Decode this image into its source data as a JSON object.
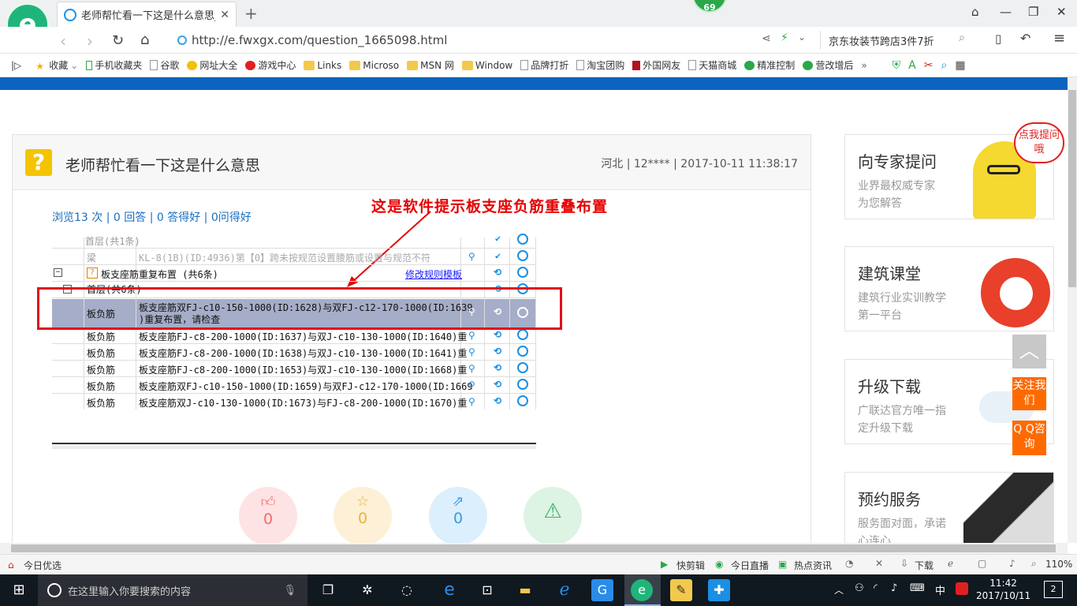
{
  "browser": {
    "tab_title": "老师帮忙看一下这是什么意思_广",
    "badge": "69",
    "url": "http://e.fwxgx.com/question_1665098.html",
    "search_placeholder": "京东妆装节跨店3件7折"
  },
  "bookmarks": [
    "收藏",
    "手机收藏夹",
    "谷歌",
    "网址大全",
    "游戏中心",
    "Links",
    "Microso",
    "MSN 网",
    "Window",
    "品牌打折",
    "淘宝团购",
    "外国网友",
    "天猫商城",
    "精准控制",
    "营改增后"
  ],
  "question": {
    "icon": "?",
    "title": "老师帮忙看一下这是什么意思",
    "meta": "河北 | 12**** | 2017-10-11 11:38:17",
    "stats": "浏览13 次 | 0 回答 | 0 答得好 | 0问得好",
    "annotation": "这是软件提示板支座负筋重叠布置"
  },
  "software": {
    "rows": [
      {
        "c1": "首层(共1条)",
        "c2": ""
      },
      {
        "c1": "梁",
        "c2": "KL-8(1B)(ID:4936)第【0】跨未按规范设置腰筋或设置与规范不符"
      },
      {
        "c1": "",
        "c2": "板支座筋重复布置 (共6条)",
        "link": "修改规则模板"
      },
      {
        "c1": "首层(共6条)",
        "c2": ""
      },
      {
        "c1": "板负筋",
        "c2": "板支座筋双FJ-c10-150-1000(ID:1628)与双FJ-c12-170-1000(ID:1639",
        "c2b": ")重复布置，请检查"
      },
      {
        "c1": "板负筋",
        "c2": "板支座筋FJ-c8-200-1000(ID:1637)与双J-c10-130-1000(ID:1640)重"
      },
      {
        "c1": "板负筋",
        "c2": "板支座筋FJ-c8-200-1000(ID:1638)与双J-c10-130-1000(ID:1641)重"
      },
      {
        "c1": "板负筋",
        "c2": "板支座筋FJ-c8-200-1000(ID:1653)与双J-c10-130-1000(ID:1668)重"
      },
      {
        "c1": "板负筋",
        "c2": "板支座筋双FJ-c10-150-1000(ID:1659)与双FJ-c12-170-1000(ID:1669"
      },
      {
        "c1": "板负筋",
        "c2": "板支座筋双J-c10-130-1000(ID:1673)与FJ-c8-200-1000(ID:1670)重"
      }
    ]
  },
  "actions": [
    {
      "label": "0",
      "icon": "thumb-icon",
      "color": "#f26b6b",
      "bg": "#fde3e3"
    },
    {
      "label": "0",
      "icon": "star-icon",
      "color": "#e8b43c",
      "bg": "#fdf0d6"
    },
    {
      "label": "0",
      "icon": "share-icon",
      "color": "#3a9be0",
      "bg": "#dceffc"
    },
    {
      "label": "",
      "icon": "warning-icon",
      "color": "#3bb36b",
      "bg": "#ddf3e4"
    }
  ],
  "sidebar": {
    "cards": [
      {
        "title": "向专家提问",
        "sub": "业界最权威专家为您解答",
        "bubble": "点我提问哦"
      },
      {
        "title": "建筑课堂",
        "sub": "建筑行业实训教学第一平台"
      },
      {
        "title": "升级下载",
        "sub": "广联达官方唯一指定升级下载"
      },
      {
        "title": "预约服务",
        "sub": "服务面对面，承诺心连心"
      }
    ],
    "follow": "关注我们",
    "qq": "Q Q咨询"
  },
  "statusbar": {
    "left": "今日优选",
    "items": [
      "快剪辑",
      "今日直播",
      "热点资讯",
      "下载"
    ],
    "zoom": "110%"
  },
  "taskbar": {
    "search_placeholder": "在这里输入你要搜索的内容",
    "ime": "中",
    "time": "11:42",
    "date": "2017/10/11",
    "notify": "2"
  }
}
